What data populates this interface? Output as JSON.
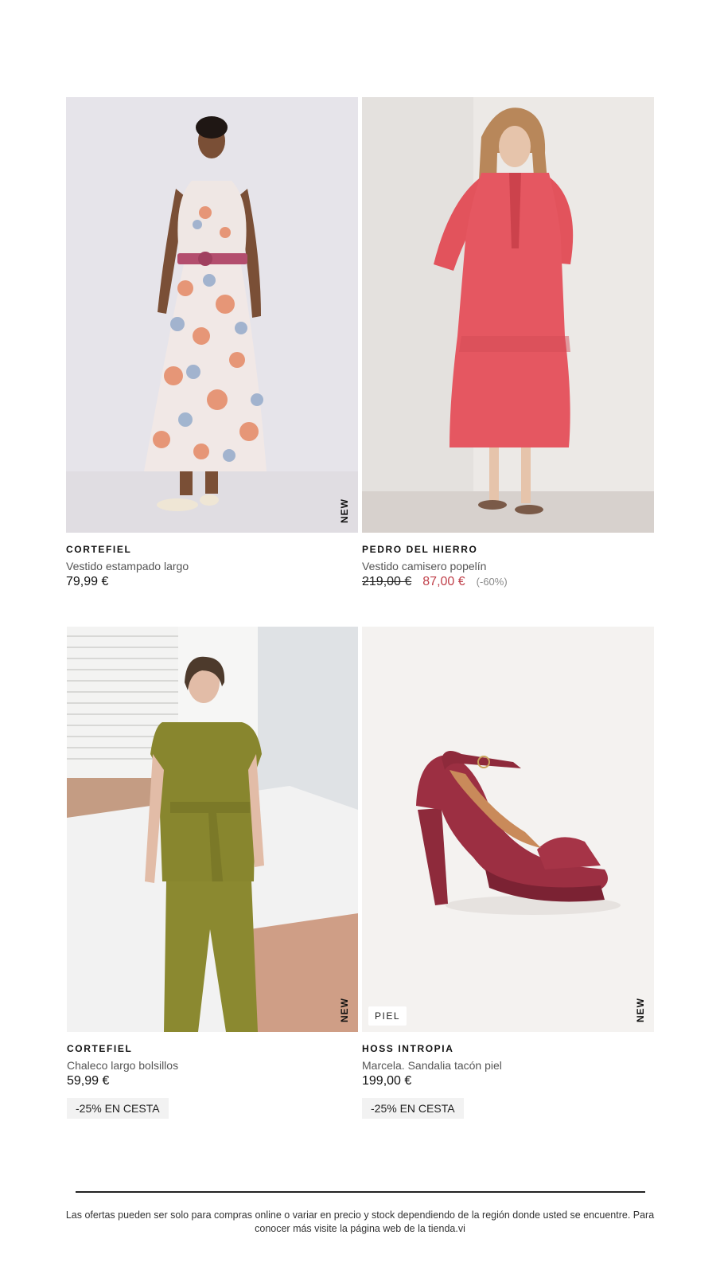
{
  "products": [
    {
      "brand": "CORTEFIEL",
      "name": "Vestido estampado largo",
      "price": "79,99 €",
      "badge": "NEW"
    },
    {
      "brand": "PEDRO DEL HIERRO",
      "name": "Vestido camisero popelín",
      "old_price": "219,00 €",
      "sale_price": "87,00 €",
      "discount": "(-60%)"
    },
    {
      "brand": "CORTEFIEL",
      "name": "Chaleco largo bolsillos",
      "price": "59,99 €",
      "badge": "NEW",
      "promo": "-25% EN CESTA"
    },
    {
      "brand": "HOSS INTROPIA",
      "name": "Marcela. Sandalia tacón piel",
      "price": "199,00 €",
      "badge": "NEW",
      "tag": "PIEL",
      "promo": "-25% EN CESTA"
    }
  ],
  "footer": {
    "disclaimer": "Las ofertas pueden ser solo para compras online o variar en precio y stock dependiendo de la región donde usted se encuentre. Para conocer más visite la página web de la tienda.vi"
  },
  "colors": {
    "sale": "#c0404a",
    "promo_bg": "#f2f2f2"
  }
}
